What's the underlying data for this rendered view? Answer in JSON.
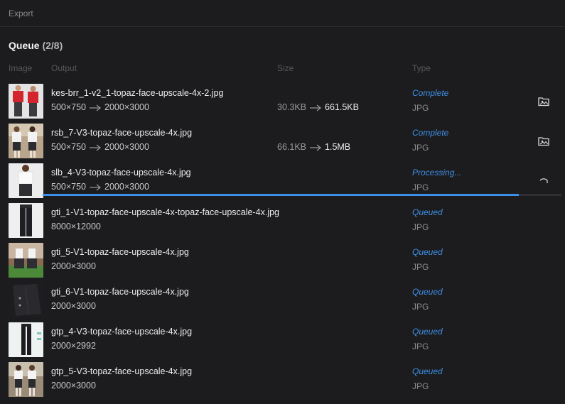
{
  "header": {
    "title": "Export"
  },
  "queue": {
    "title": "Queue",
    "count": "(2/8)"
  },
  "columns": {
    "image": "Image",
    "output": "Output",
    "size": "Size",
    "type": "Type"
  },
  "colors": {
    "accent": "#3b8fea",
    "status": "#3d8fe6"
  },
  "progress": {
    "fraction": 0.918
  },
  "rows": [
    {
      "filename": "kes-brr_1-v2_1-topaz-face-upscale-4x-2.jpg",
      "dims_from": "500×750",
      "dims_to": "2000×3000",
      "size_from": "30.3KB",
      "size_to": "661.5KB",
      "status": "Complete",
      "type": "JPG",
      "action_icon": "folder-image-icon"
    },
    {
      "filename": "rsb_7-V3-topaz-face-upscale-4x.jpg",
      "dims_from": "500×750",
      "dims_to": "2000×3000",
      "size_from": "66.1KB",
      "size_to": "1.5MB",
      "status": "Complete",
      "type": "JPG",
      "action_icon": "folder-image-icon"
    },
    {
      "filename": "slb_4-V3-topaz-face-upscale-4x.jpg",
      "dims_from": "500×750",
      "dims_to": "2000×3000",
      "size_from": "",
      "size_to": "",
      "status": "Processing...",
      "type": "JPG",
      "action_icon": "spinner-icon"
    },
    {
      "filename": "gti_1-V1-topaz-face-upscale-4x-topaz-face-upscale-4x.jpg",
      "dims_from": "",
      "dims_to": "8000×12000",
      "size_from": "",
      "size_to": "",
      "status": "Queued",
      "type": "JPG",
      "action_icon": ""
    },
    {
      "filename": "gti_5-V1-topaz-face-upscale-4x.jpg",
      "dims_from": "",
      "dims_to": "2000×3000",
      "size_from": "",
      "size_to": "",
      "status": "Queued",
      "type": "JPG",
      "action_icon": ""
    },
    {
      "filename": "gti_6-V1-topaz-face-upscale-4x.jpg",
      "dims_from": "",
      "dims_to": "2000×3000",
      "size_from": "",
      "size_to": "",
      "status": "Queued",
      "type": "JPG",
      "action_icon": ""
    },
    {
      "filename": "gtp_4-V3-topaz-face-upscale-4x.jpg",
      "dims_from": "",
      "dims_to": "2000×2992",
      "size_from": "",
      "size_to": "",
      "status": "Queued",
      "type": "JPG",
      "action_icon": ""
    },
    {
      "filename": "gtp_5-V3-topaz-face-upscale-4x.jpg",
      "dims_from": "",
      "dims_to": "2000×3000",
      "size_from": "",
      "size_to": "",
      "status": "Queued",
      "type": "JPG",
      "action_icon": ""
    }
  ]
}
